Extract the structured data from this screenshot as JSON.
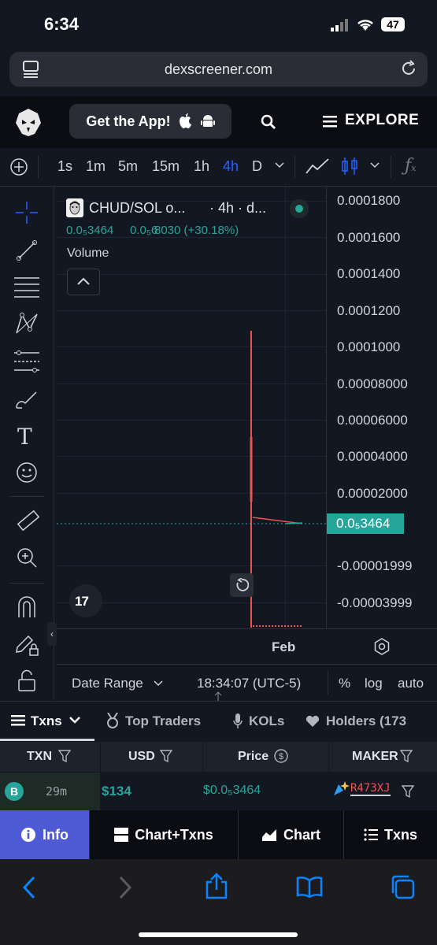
{
  "status": {
    "time": "6:34",
    "battery": "47"
  },
  "browser": {
    "url": "dexscreener.com"
  },
  "nav": {
    "get_app": "Get the App!",
    "explore": "EXPLORE"
  },
  "timeframes": [
    "1s",
    "1m",
    "5m",
    "15m",
    "1h",
    "4h",
    "D"
  ],
  "active_timeframe": "4h",
  "chart": {
    "pair": "CHUD/SOL o...",
    "interval": "· 4h · d...",
    "price_line": "0.0₅3464",
    "open_value": "0.0₅6",
    "change": "8030 (+30.18%)",
    "volume_label": "Volume",
    "current_price_tag": "0.0₅3464",
    "y_labels": [
      "0.0001800",
      "0.0001600",
      "0.0001400",
      "0.0001200",
      "0.0001000",
      "0.00008000",
      "0.00006000",
      "0.00004000",
      "0.00002000",
      "-0.00001999",
      "-0.00003999"
    ],
    "x_label": "Feb",
    "date_range": "Date Range",
    "clock": "18:34:07 (UTC-5)",
    "pct": "%",
    "log": "log",
    "auto": "auto",
    "accent_up": "#26a69a",
    "accent_down": "#ef5350"
  },
  "tabs": {
    "txns": "Txns",
    "top_traders": "Top Traders",
    "kols": "KOLs",
    "holders": "Holders (173"
  },
  "table": {
    "headers": {
      "txn": "TXN",
      "usd": "USD",
      "price": "Price",
      "maker": "MAKER"
    },
    "row": {
      "badge": "B",
      "age": "29m",
      "usd": "$134",
      "price": "$0.0₅3464",
      "maker": "R473XJ"
    }
  },
  "bottom_tabs": {
    "info": "Info",
    "chart_txns": "Chart+Txns",
    "chart": "Chart",
    "txns": "Txns"
  }
}
